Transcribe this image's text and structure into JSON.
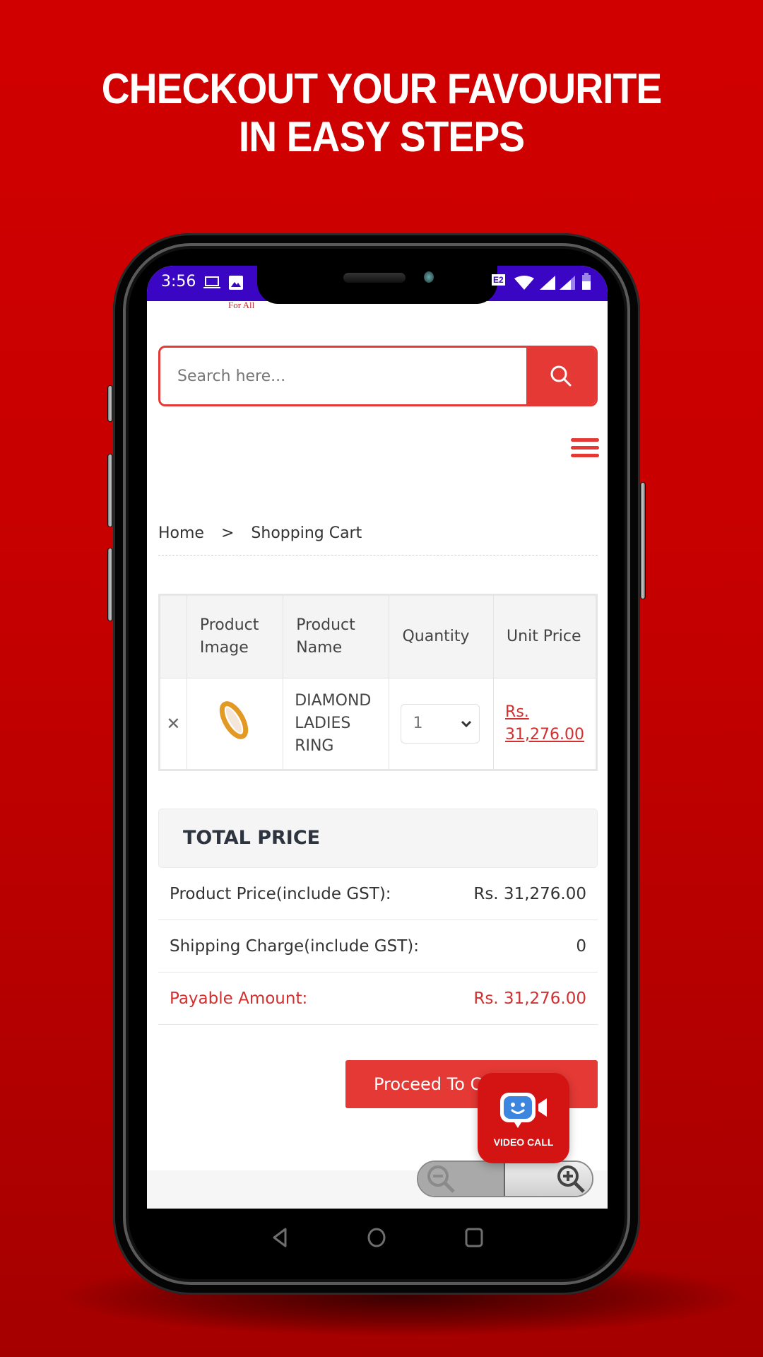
{
  "headline": {
    "line1": "CHECKOUT YOUR FAVOURITE",
    "line2": "IN EASY STEPS"
  },
  "status_bar": {
    "time": "3:56",
    "left_icons": [
      "laptop-icon",
      "image-icon"
    ],
    "right_icons": [
      "e2-badge-icon",
      "wifi-icon",
      "signal-icon",
      "signal-icon-2",
      "battery-icon"
    ],
    "e2_label": "E2"
  },
  "app": {
    "logo_fragment": "For All",
    "accent_color": "#e53935",
    "status_bar_color": "#3a06c4",
    "search": {
      "placeholder": "Search here...",
      "value": ""
    },
    "breadcrumb": {
      "home": "Home",
      "separator": ">",
      "current": "Shopping Cart"
    },
    "cart_table": {
      "headers": [
        "",
        "Product Image",
        "Product Name",
        "Quantity",
        "Unit Price"
      ],
      "rows": [
        {
          "remove": "✕",
          "image_alt": "diamond ladies ring",
          "name": "DIAMOND LADIES RING",
          "quantity": "1",
          "unit_price": "Rs. 31,276.00"
        }
      ]
    },
    "total": {
      "title": "TOTAL PRICE",
      "rows": [
        {
          "label": "Product Price(include GST):",
          "value": "Rs. 31,276.00"
        },
        {
          "label": "Shipping Charge(include GST):",
          "value": "0"
        },
        {
          "label": "Payable Amount:",
          "value": "Rs. 31,276.00"
        }
      ]
    },
    "proceed_label": "Proceed To Checkout",
    "video_call_label": "VIDEO CALL"
  },
  "nav_bar": {
    "buttons": [
      "back",
      "home",
      "recents"
    ]
  }
}
